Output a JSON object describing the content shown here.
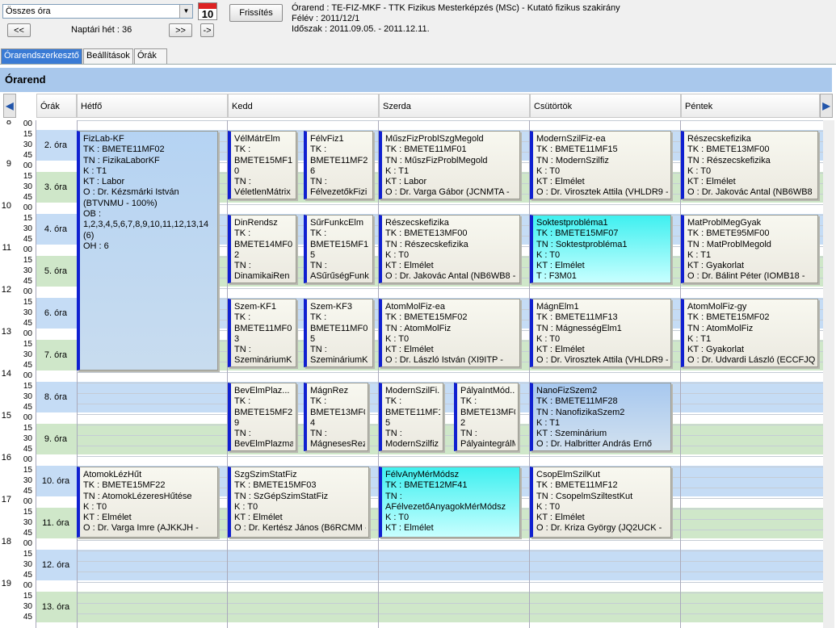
{
  "toolbar": {
    "combo_value": "Összes óra",
    "calendar_num": "10",
    "refresh": "Frissítés",
    "prev": "<<",
    "next": ">>",
    "last": "->",
    "week_label": "Naptári hét : 36"
  },
  "info": {
    "line1": "Órarend : TE-FIZ-MKF - TTK Fizikus Mesterképzés (MSc) - Kutató fizikus szakirány",
    "line2": "Félév : 2011/12/1",
    "line3": "Időszak : 2011.09.05. - 2011.12.11."
  },
  "tabs": [
    "Órarendszerkesztő",
    "Beállítások",
    "Órák"
  ],
  "section_title": "Órarend",
  "columns": {
    "orak": "Órák",
    "days": [
      "Hétfő",
      "Kedd",
      "Szerda",
      "Csütörtök",
      "Péntek"
    ]
  },
  "colors": {
    "accent": "#3a7bd5",
    "card_bar": "#1020d0",
    "cyan": "#3ff0f0",
    "row_blue": "#c5dcf5",
    "row_green": "#cfe7c9"
  },
  "times": [
    "8",
    "00",
    "15",
    "30",
    "45",
    "9",
    "00",
    "15",
    "30",
    "45",
    "10",
    "00",
    "15",
    "30",
    "45",
    "11",
    "00",
    "15",
    "30",
    "45",
    "12",
    "00",
    "15",
    "30",
    "45",
    "13",
    "00",
    "15",
    "30",
    "45",
    "14",
    "00",
    "15",
    "30",
    "45",
    "15",
    "00",
    "15",
    "30",
    "45",
    "16",
    "00",
    "15",
    "30",
    "45",
    "17",
    "00",
    "15",
    "30",
    "45",
    "18",
    "00",
    "15",
    "30",
    "45",
    "19",
    "00",
    "15",
    "30",
    "45"
  ],
  "ora_labels": [
    "2. óra",
    "3. óra",
    "4. óra",
    "5. óra",
    "6. óra",
    "7. óra",
    "8. óra",
    "9. óra",
    "10. óra",
    "11. óra",
    "12. óra",
    "13. óra"
  ],
  "cards": [
    {
      "lines": [
        "FizLab-KF",
        "TK : BMETE11MF02",
        "TN : FizikaLaborKF",
        "K : T1",
        "KT : Labor",
        "O : Dr. Kézsmárki István (BTVNMU - 100%)",
        "OB : 1,2,3,4,5,6,7,8,9,10,11,12,13,14 (6)",
        "OH : 6"
      ]
    },
    {
      "lines": [
        "VélMátrElm",
        "TK :",
        "BMETE15MF1",
        "0",
        "TN :",
        "VéletlenMátrix"
      ]
    },
    {
      "lines": [
        "FélvFiz1",
        "TK :",
        "BMETE11MF2",
        "6",
        "TN :",
        "FélvezetőkFizi"
      ]
    },
    {
      "lines": [
        "MűszFizProblSzgMegold",
        "TK : BMETE11MF01",
        "TN : MűszFizProblMegold",
        "K : T1",
        "KT : Labor",
        "O : Dr. Varga Gábor (JCNMTA -"
      ]
    },
    {
      "lines": [
        "ModernSzilFiz-ea",
        "TK : BMETE11MF15",
        "TN : ModernSzilfiz",
        "K : T0",
        "KT : Elmélet",
        "O : Dr. Virosztek Attila (VHLDR9 -"
      ]
    },
    {
      "lines": [
        "Részecskefizika",
        "TK : BMETE13MF00",
        "TN : Részecskefizika",
        "K : T0",
        "KT : Elmélet",
        "O : Dr. Jakovác Antal (NB6WB8 -"
      ]
    },
    {
      "lines": [
        "DinRendsz",
        "TK :",
        "BMETE14MF0",
        "2",
        "TN :",
        "DinamikaiRen"
      ]
    },
    {
      "lines": [
        "SűrFunkcElm",
        "TK :",
        "BMETE15MF1",
        "5",
        "TN :",
        "ASűrűségFunk"
      ]
    },
    {
      "lines": [
        "Részecskefizika",
        "TK : BMETE13MF00",
        "TN : Részecskefizika",
        "K : T0",
        "KT : Elmélet",
        "O : Dr. Jakovác Antal (NB6WB8 -"
      ]
    },
    {
      "lines": [
        "Soktestprobléma1",
        "TK : BMETE15MF07",
        "TN : Soktestprobléma1",
        "K : T0",
        "KT : Elmélet",
        "T : F3M01"
      ]
    },
    {
      "lines": [
        "MatProblMegGyak",
        "TK : BMETE95MF00",
        "TN : MatProblMegold",
        "K : T1",
        "KT : Gyakorlat",
        "O : Dr. Bálint Péter (IOMB18 -"
      ]
    },
    {
      "lines": [
        "Szem-KF1",
        "TK :",
        "BMETE11MF0",
        "3",
        "TN :",
        "SzemináriumK"
      ]
    },
    {
      "lines": [
        "Szem-KF3",
        "TK :",
        "BMETE11MF0",
        "5",
        "TN :",
        "SzemináriumK"
      ]
    },
    {
      "lines": [
        "AtomMolFiz-ea",
        "TK : BMETE15MF02",
        "TN : AtomMolFiz",
        "K : T0",
        "KT : Elmélet",
        "O : Dr. László István (XI9ITP -"
      ]
    },
    {
      "lines": [
        "MágnElm1",
        "TK : BMETE11MF13",
        "TN : MágnességElm1",
        "K : T0",
        "KT : Elmélet",
        "O : Dr. Virosztek Attila (VHLDR9 -"
      ]
    },
    {
      "lines": [
        "AtomMolFiz-gy",
        "TK : BMETE15MF02",
        "TN : AtomMolFiz",
        "K : T1",
        "KT : Gyakorlat",
        "O : Dr. Udvardi László (ECCFJQ -"
      ]
    },
    {
      "lines": [
        "BevElmPlaz...",
        "TK :",
        "BMETE15MF2",
        "9",
        "TN :",
        "BevElmPlazma"
      ]
    },
    {
      "lines": [
        "MágnRez",
        "TK :",
        "BMETE13MF0",
        "4",
        "TN :",
        "MágnesesRez"
      ]
    },
    {
      "lines": [
        "ModernSzilFi...",
        "TK :",
        "BMETE11MF1",
        "5",
        "TN :",
        "ModernSzilfiz"
      ]
    },
    {
      "lines": [
        "PályaIntMód...",
        "TK :",
        "BMETE13MF0",
        "2",
        "TN :",
        "PályaintegrálM"
      ]
    },
    {
      "lines": [
        "NanoFizSzem2",
        "TK : BMETE11MF28",
        "TN : NanofizikaSzem2",
        "K : T1",
        "KT : Szeminárium",
        "O : Dr. Halbritter András Ernő"
      ]
    },
    {
      "lines": [
        "AtomokLézHűt",
        "TK : BMETE15MF22",
        "TN : AtomokLézeresHűtése",
        "K : T0",
        "KT : Elmélet",
        "O : Dr. Varga Imre (AJKKJH -"
      ]
    },
    {
      "lines": [
        "SzgSzimStatFiz",
        "TK : BMETE15MF03",
        "TN : SzGépSzimStatFiz",
        "K : T0",
        "KT : Elmélet",
        "O : Dr. Kertész János (B6RCMM -"
      ]
    },
    {
      "lines": [
        "FélvAnyMérMódsz",
        "TK : BMETE12MF41",
        "TN :",
        "AFélvezetőAnyagokMérMódsz",
        "K : T0",
        "KT : Elmélet"
      ]
    },
    {
      "lines": [
        "CsopElmSzilKut",
        "TK : BMETE11MF12",
        "TN : CsopelmSziltestKut",
        "K : T0",
        "KT : Elmélet",
        "O : Dr. Kriza György (JQ2UCK -"
      ]
    }
  ]
}
